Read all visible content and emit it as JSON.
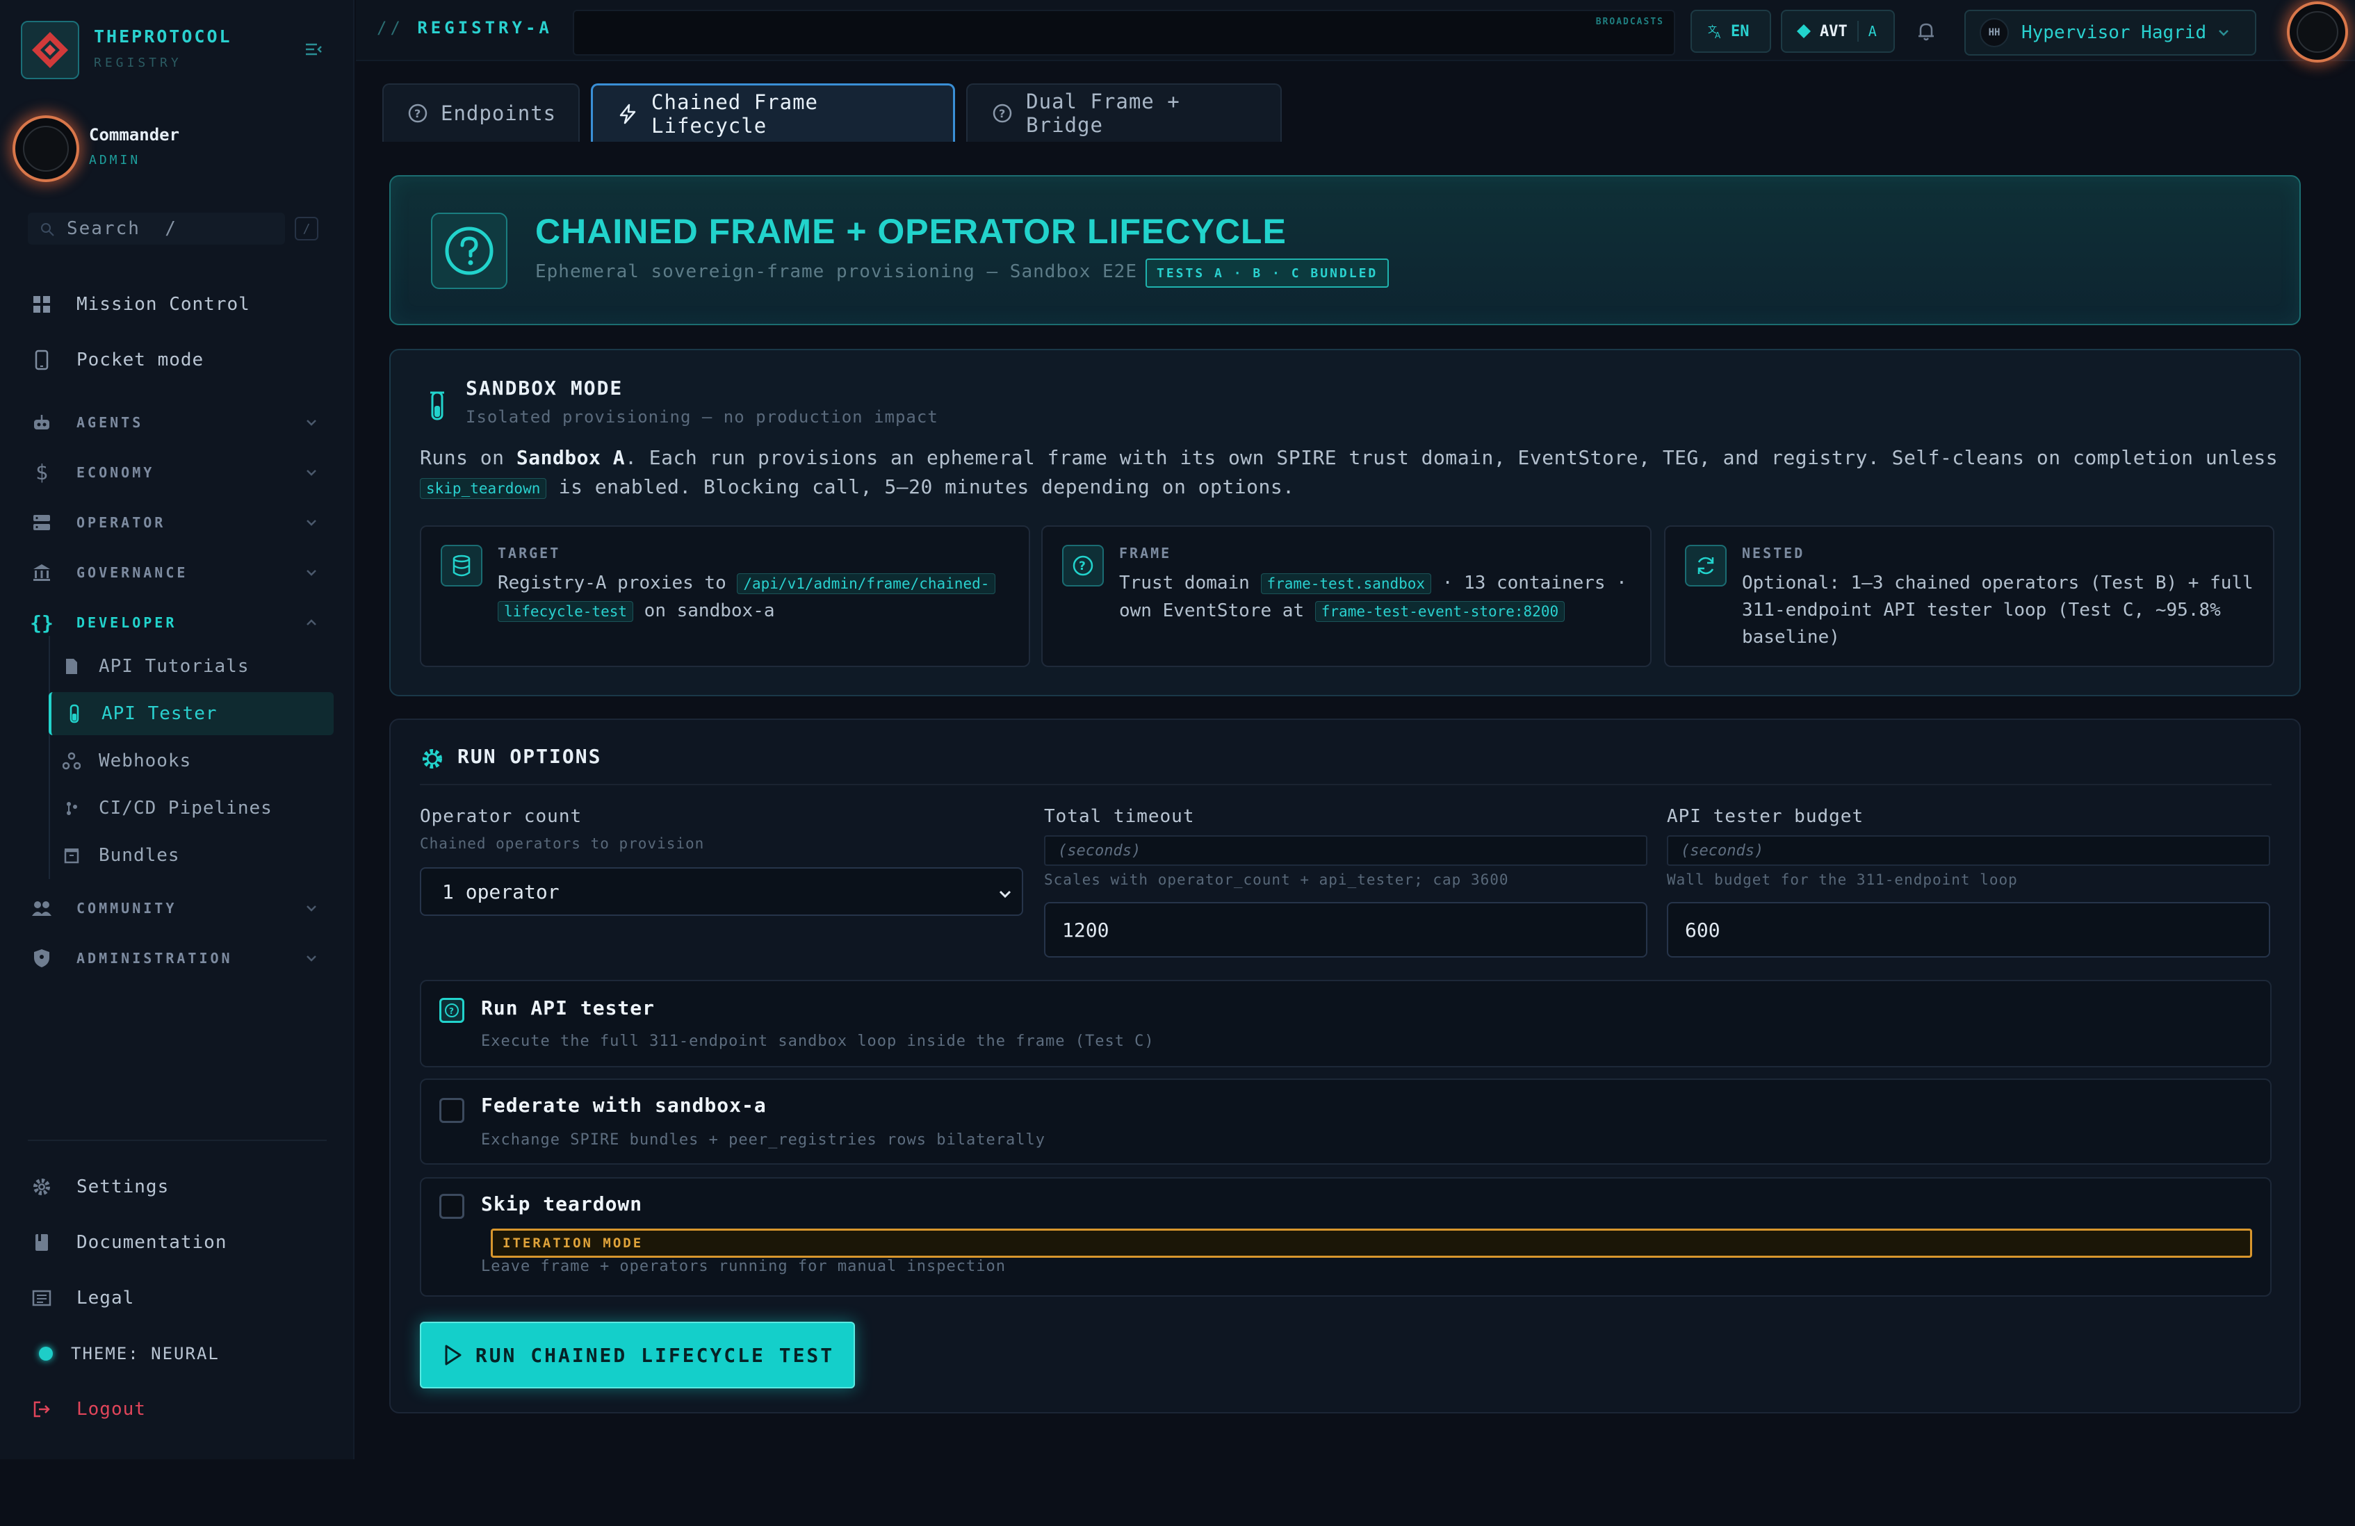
{
  "sidebar": {
    "brand_name": "THEPROTOCOL",
    "brand_sub": "REGISTRY",
    "user_name": "Commander",
    "user_role": "ADMIN",
    "search_placeholder": "Search  /",
    "search_shortcut": "/",
    "items": [
      {
        "label": "Mission Control",
        "icon": "grid-icon"
      },
      {
        "label": "Pocket mode",
        "icon": "phone-icon"
      }
    ],
    "sections": [
      {
        "label": "AGENTS",
        "icon": "robot-icon"
      },
      {
        "label": "ECONOMY",
        "icon": "dollar-icon"
      },
      {
        "label": "OPERATOR",
        "icon": "server-icon"
      },
      {
        "label": "GOVERNANCE",
        "icon": "bank-icon"
      },
      {
        "label": "DEVELOPER",
        "icon": "braces-icon"
      },
      {
        "label": "COMMUNITY",
        "icon": "people-icon"
      },
      {
        "label": "ADMINISTRATION",
        "icon": "shield-icon"
      }
    ],
    "developer_items": [
      {
        "label": "API Tutorials",
        "icon": "doc-icon"
      },
      {
        "label": "API Tester",
        "icon": "flask-icon"
      },
      {
        "label": "Webhooks",
        "icon": "webhook-icon"
      },
      {
        "label": "CI/CD Pipelines",
        "icon": "pipeline-icon"
      },
      {
        "label": "Bundles",
        "icon": "box-icon"
      }
    ],
    "footer": {
      "settings": "Settings",
      "documentation": "Documentation",
      "legal": "Legal",
      "theme": "THEME: NEURAL",
      "logout": "Logout"
    }
  },
  "topbar": {
    "crumb_prefix": "//",
    "crumb": "REGISTRY-A",
    "broadcasts_label": "BROADCASTS",
    "lang": "EN",
    "currency": "AVT",
    "currency_sub": "A",
    "user_initials": "HH",
    "user_name": "Hypervisor Hagrid"
  },
  "tabs": [
    {
      "label": "Endpoints"
    },
    {
      "label": "Chained Frame Lifecycle"
    },
    {
      "label": "Dual Frame + Bridge"
    }
  ],
  "hero": {
    "title": "CHAINED FRAME + OPERATOR LIFECYCLE",
    "subtitle": "Ephemeral sovereign-frame provisioning — Sandbox E2E",
    "badge": "TESTS A · B · C BUNDLED"
  },
  "sandbox": {
    "title": "SANDBOX MODE",
    "subtitle": "Isolated provisioning — no production impact",
    "body_pre": "Runs on ",
    "body_bold": "Sandbox A",
    "body_post": ". Each run provisions an ephemeral frame with its own SPIRE trust domain, EventStore, TEG, and registry. Self-cleans on completion unless",
    "body_code": "skip_teardown",
    "body_end": " is enabled. Blocking call, 5–20 minutes depending on options.",
    "cards": [
      {
        "head": "TARGET",
        "t1": "Registry-A proxies to ",
        "c1": "/api/v1/admin/frame/chained-",
        "c1b": "lifecycle-test",
        "t2": " on sandbox-a"
      },
      {
        "head": "FRAME",
        "t1": "Trust domain ",
        "c1": "frame-test.sandbox",
        "t2": " · 13 containers ·",
        "t3": "own EventStore at ",
        "c2": "frame-test-event-store:8200"
      },
      {
        "head": "NESTED",
        "t1": "Optional: 1–3 chained operators (Test B) + full 311-endpoint API tester loop (Test C, ~95.8% baseline)"
      }
    ]
  },
  "run_options": {
    "title": "RUN OPTIONS",
    "operator_count_label": "Operator count",
    "operator_count_hint": "Chained operators to provision",
    "operator_count_value": "1 operator",
    "timeout_label": "Total timeout",
    "timeout_unit_placeholder": "(seconds)",
    "timeout_hint": "Scales with operator_count + api_tester; cap 3600",
    "timeout_value": "1200",
    "budget_label": "API tester budget",
    "budget_unit_placeholder": "(seconds)",
    "budget_hint": "Wall budget for the 311-endpoint loop",
    "budget_value": "600",
    "options": [
      {
        "title": "Run API tester",
        "desc": "Execute the full 311-endpoint sandbox loop inside the frame (Test C)",
        "checked": true
      },
      {
        "title": "Federate with sandbox-a",
        "desc": "Exchange SPIRE bundles + peer_registries rows bilaterally",
        "checked": false
      },
      {
        "title": "Skip teardown",
        "badge": "ITERATION MODE",
        "desc": "Leave frame + operators running for manual inspection",
        "checked": false
      }
    ],
    "run_button": "RUN CHAINED LIFECYCLE TEST"
  },
  "colors": {
    "accent": "#22d3cc",
    "background": "#0b0f18",
    "warning": "#d8962d",
    "logout": "#e0455a"
  }
}
